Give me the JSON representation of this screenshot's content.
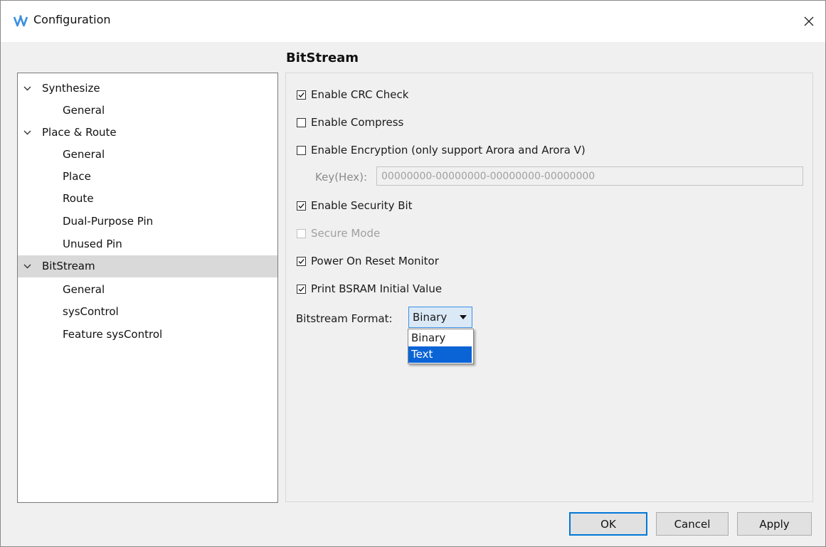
{
  "window": {
    "title": "Configuration"
  },
  "heading": "BitStream",
  "tree": {
    "items": [
      {
        "label": "Synthesize",
        "level": 0,
        "expanded": true
      },
      {
        "label": "General",
        "level": 1
      },
      {
        "label": "Place & Route",
        "level": 0,
        "expanded": true
      },
      {
        "label": "General",
        "level": 1
      },
      {
        "label": "Place",
        "level": 1
      },
      {
        "label": "Route",
        "level": 1
      },
      {
        "label": "Dual-Purpose Pin",
        "level": 1
      },
      {
        "label": "Unused Pin",
        "level": 1
      },
      {
        "label": "BitStream",
        "level": 0,
        "expanded": true,
        "selected": true
      },
      {
        "label": "General",
        "level": 1
      },
      {
        "label": "sysControl",
        "level": 1
      },
      {
        "label": "Feature sysControl",
        "level": 1
      }
    ]
  },
  "options": {
    "crc": {
      "label": "Enable CRC Check",
      "checked": true
    },
    "compress": {
      "label": "Enable Compress",
      "checked": false
    },
    "encryption": {
      "label": "Enable Encryption (only support Arora and Arora V)",
      "checked": false
    },
    "key": {
      "label": "Key(Hex):",
      "value": "00000000-00000000-00000000-00000000"
    },
    "security": {
      "label": "Enable Security Bit",
      "checked": true
    },
    "secure_mode": {
      "label": "Secure Mode",
      "checked": false,
      "disabled": true
    },
    "power_on_reset": {
      "label": "Power On Reset Monitor",
      "checked": true
    },
    "print_bsram": {
      "label": "Print BSRAM Initial Value",
      "checked": true
    }
  },
  "format": {
    "label": "Bitstream Format:",
    "selected": "Binary",
    "options": [
      "Binary",
      "Text"
    ],
    "highlighted": "Text"
  },
  "buttons": {
    "ok": "OK",
    "cancel": "Cancel",
    "apply": "Apply"
  },
  "colors": {
    "accent": "#0078d7",
    "selection": "#0a64d6",
    "tree_selected": "#d9d9d9"
  }
}
